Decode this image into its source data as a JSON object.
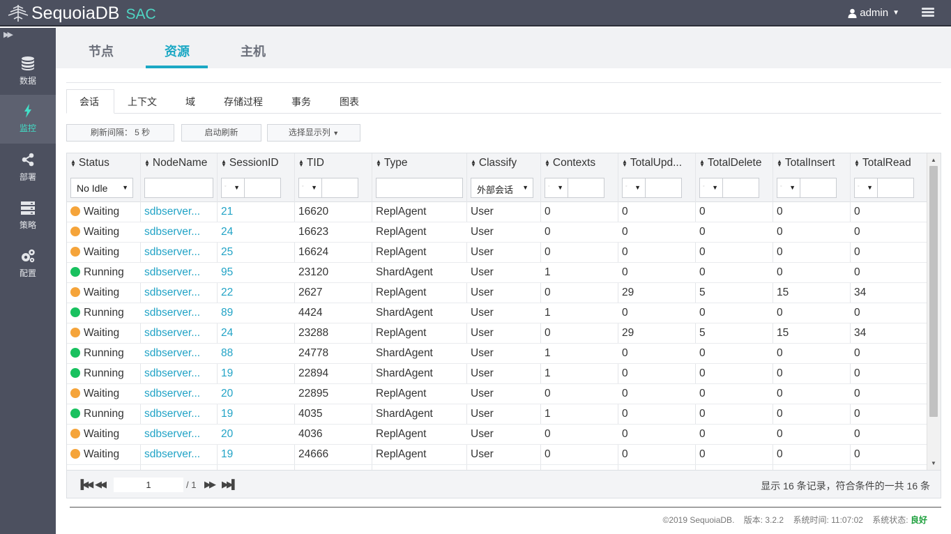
{
  "app": {
    "name": "SequoiaDB",
    "suffix": "SAC"
  },
  "user": {
    "name": "admin"
  },
  "sidebar": {
    "items": [
      {
        "label": "数据",
        "icon": "database-icon"
      },
      {
        "label": "监控",
        "icon": "lightning-icon",
        "active": true
      },
      {
        "label": "部署",
        "icon": "share-icon"
      },
      {
        "label": "策略",
        "icon": "server-icon"
      },
      {
        "label": "配置",
        "icon": "gears-icon"
      }
    ]
  },
  "main_tabs": [
    {
      "label": "节点"
    },
    {
      "label": "资源",
      "active": true
    },
    {
      "label": "主机"
    }
  ],
  "sub_tabs": [
    {
      "label": "会话",
      "active": true
    },
    {
      "label": "上下文"
    },
    {
      "label": "域"
    },
    {
      "label": "存储过程"
    },
    {
      "label": "事务"
    },
    {
      "label": "图表"
    }
  ],
  "toolbar": {
    "refresh_interval": "刷新间隔： 5 秒",
    "start_refresh": "启动刷新",
    "select_columns": "选择显示列"
  },
  "table": {
    "columns": [
      "Status",
      "NodeName",
      "SessionID",
      "TID",
      "Type",
      "Classify",
      "Contexts",
      "TotalUpd...",
      "TotalDelete",
      "TotalInsert",
      "TotalRead"
    ],
    "filters": {
      "status": "No Idle",
      "classify": "外部会话"
    },
    "rows": [
      {
        "status": "Waiting",
        "node": "sdbserver...",
        "session": "21",
        "tid": "16620",
        "type": "ReplAgent",
        "classify": "User",
        "contexts": "0",
        "upd": "0",
        "del": "0",
        "ins": "0",
        "read": "0"
      },
      {
        "status": "Waiting",
        "node": "sdbserver...",
        "session": "24",
        "tid": "16623",
        "type": "ReplAgent",
        "classify": "User",
        "contexts": "0",
        "upd": "0",
        "del": "0",
        "ins": "0",
        "read": "0"
      },
      {
        "status": "Waiting",
        "node": "sdbserver...",
        "session": "25",
        "tid": "16624",
        "type": "ReplAgent",
        "classify": "User",
        "contexts": "0",
        "upd": "0",
        "del": "0",
        "ins": "0",
        "read": "0"
      },
      {
        "status": "Running",
        "node": "sdbserver...",
        "session": "95",
        "tid": "23120",
        "type": "ShardAgent",
        "classify": "User",
        "contexts": "1",
        "upd": "0",
        "del": "0",
        "ins": "0",
        "read": "0"
      },
      {
        "status": "Waiting",
        "node": "sdbserver...",
        "session": "22",
        "tid": "2627",
        "type": "ReplAgent",
        "classify": "User",
        "contexts": "0",
        "upd": "29",
        "del": "5",
        "ins": "15",
        "read": "34"
      },
      {
        "status": "Running",
        "node": "sdbserver...",
        "session": "89",
        "tid": "4424",
        "type": "ShardAgent",
        "classify": "User",
        "contexts": "1",
        "upd": "0",
        "del": "0",
        "ins": "0",
        "read": "0"
      },
      {
        "status": "Waiting",
        "node": "sdbserver...",
        "session": "24",
        "tid": "23288",
        "type": "ReplAgent",
        "classify": "User",
        "contexts": "0",
        "upd": "29",
        "del": "5",
        "ins": "15",
        "read": "34"
      },
      {
        "status": "Running",
        "node": "sdbserver...",
        "session": "88",
        "tid": "24778",
        "type": "ShardAgent",
        "classify": "User",
        "contexts": "1",
        "upd": "0",
        "del": "0",
        "ins": "0",
        "read": "0"
      },
      {
        "status": "Running",
        "node": "sdbserver...",
        "session": "19",
        "tid": "22894",
        "type": "ShardAgent",
        "classify": "User",
        "contexts": "1",
        "upd": "0",
        "del": "0",
        "ins": "0",
        "read": "0"
      },
      {
        "status": "Waiting",
        "node": "sdbserver...",
        "session": "20",
        "tid": "22895",
        "type": "ReplAgent",
        "classify": "User",
        "contexts": "0",
        "upd": "0",
        "del": "0",
        "ins": "0",
        "read": "0"
      },
      {
        "status": "Running",
        "node": "sdbserver...",
        "session": "19",
        "tid": "4035",
        "type": "ShardAgent",
        "classify": "User",
        "contexts": "1",
        "upd": "0",
        "del": "0",
        "ins": "0",
        "read": "0"
      },
      {
        "status": "Waiting",
        "node": "sdbserver...",
        "session": "20",
        "tid": "4036",
        "type": "ReplAgent",
        "classify": "User",
        "contexts": "0",
        "upd": "0",
        "del": "0",
        "ins": "0",
        "read": "0"
      },
      {
        "status": "Waiting",
        "node": "sdbserver...",
        "session": "19",
        "tid": "24666",
        "type": "ReplAgent",
        "classify": "User",
        "contexts": "0",
        "upd": "0",
        "del": "0",
        "ins": "0",
        "read": "0"
      }
    ]
  },
  "status_colors": {
    "Waiting": "#f5a43a",
    "Running": "#19c15f"
  },
  "pager": {
    "page": "1",
    "total": "/ 1",
    "info": "显示 16 条记录，符合条件的一共 16 条"
  },
  "footer": {
    "copyright": "©2019 SequoiaDB.",
    "version": "版本: 3.2.2",
    "time": "系统时间: 11:07:02",
    "status_label": "系统状态:",
    "status_value": "良好"
  }
}
